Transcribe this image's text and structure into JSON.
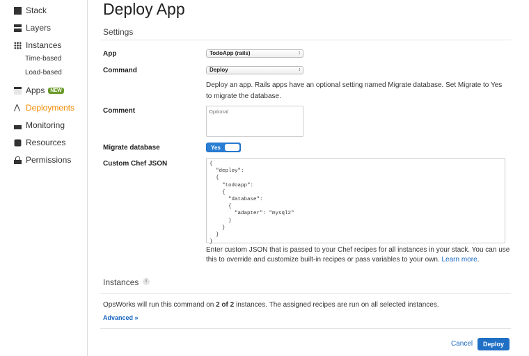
{
  "sidebar": {
    "items": [
      {
        "label": "Stack",
        "icon": "square-icon"
      },
      {
        "label": "Layers",
        "icon": "layers-icon"
      },
      {
        "label": "Instances",
        "icon": "grid-icon"
      },
      {
        "label": "Time-based"
      },
      {
        "label": "Load-based"
      },
      {
        "label": "Apps",
        "icon": "window-icon",
        "badge": "NEW"
      },
      {
        "label": "Deployments",
        "icon": "deployments-icon"
      },
      {
        "label": "Monitoring",
        "icon": "monitoring-icon"
      },
      {
        "label": "Resources",
        "icon": "cube-icon"
      },
      {
        "label": "Permissions",
        "icon": "lock-icon"
      }
    ],
    "active_color": "#f08a00"
  },
  "page": {
    "title": "Deploy App"
  },
  "settings": {
    "heading": "Settings",
    "app_label": "App",
    "app_value": "TodoApp (rails)",
    "command_label": "Command",
    "command_value": "Deploy",
    "command_help": "Deploy an app. Rails apps have an optional setting named Migrate database. Set Migrate to Yes to migrate the database.",
    "comment_label": "Comment",
    "comment_placeholder": "Optional",
    "migrate_label": "Migrate database",
    "migrate_value": "Yes",
    "json_label": "Custom Chef JSON",
    "json_value": "{\n  \"deploy\":\n  {\n    \"todoapp\":\n    {\n      \"database\":\n      {\n        \"adapter\": \"mysql2\"\n      }\n    }\n  }\n}",
    "json_help": "Enter custom JSON that is passed to your Chef recipes for all instances in your stack. You can use this to override and customize built-in recipes or pass variables to your own.",
    "learn_more": "Learn more"
  },
  "instances": {
    "heading": "Instances",
    "text_pre": "OpsWorks will run this command on ",
    "count": "2 of 2",
    "text_post": " instances. The assigned recipes are run on all selected instances.",
    "advanced": "Advanced »"
  },
  "footer": {
    "cancel": "Cancel",
    "deploy": "Deploy"
  },
  "colors": {
    "primary": "#1f6fc5",
    "link": "#1565c0"
  }
}
